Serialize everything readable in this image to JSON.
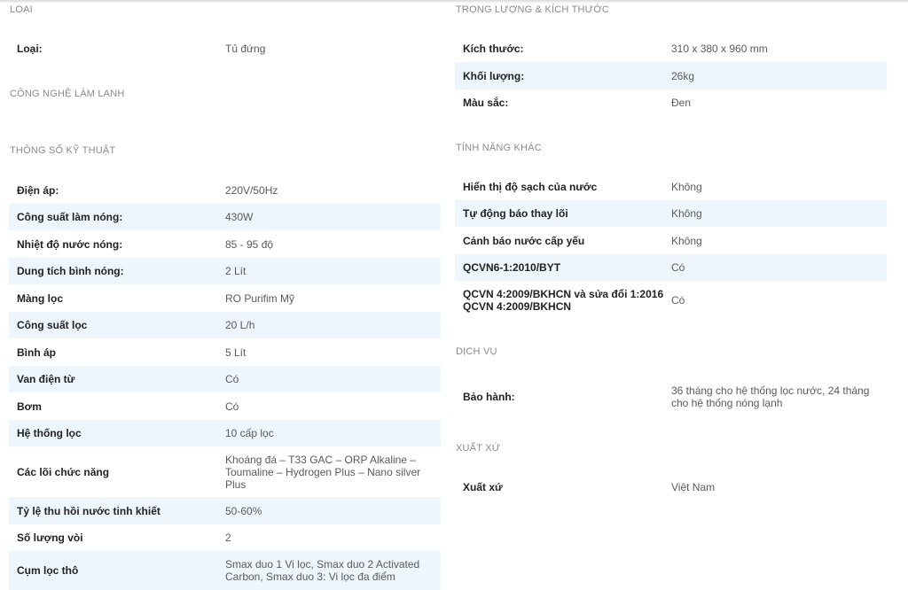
{
  "left": {
    "sections": [
      {
        "title": "LOẠI",
        "rows": [
          {
            "label": "Loại:",
            "value": "Tủ đứng"
          }
        ]
      },
      {
        "title": "CÔNG NGHỆ LÀM LẠNH",
        "rows": []
      },
      {
        "title": "THÔNG SỐ KỸ THUẬT",
        "rows": [
          {
            "label": "Điện áp:",
            "value": "220V/50Hz"
          },
          {
            "label": "Công suất làm nóng:",
            "value": "430W"
          },
          {
            "label": "Nhiệt độ nước nóng:",
            "value": "85 - 95 độ"
          },
          {
            "label": "Dung tích bình nóng:",
            "value": "2 Lít"
          },
          {
            "label": "Màng lọc",
            "value": "RO Purifim Mỹ"
          },
          {
            "label": "Công suất lọc",
            "value": "20 L/h"
          },
          {
            "label": "Bình áp",
            "value": "5 Lít"
          },
          {
            "label": "Van điện từ",
            "value": "Có"
          },
          {
            "label": "Bơm",
            "value": "Có"
          },
          {
            "label": "Hệ thống lọc",
            "value": "10 cấp lọc"
          },
          {
            "label": "Các lõi chức năng",
            "value": "Khoáng đá – T33 GAC – ORP Alkaline – Toumaline – Hydrogen Plus – Nano silver Plus"
          },
          {
            "label": "Tỷ lệ thu hồi nước tinh khiết",
            "value": "50-60%"
          },
          {
            "label": "Số lượng vòi",
            "value": "2"
          },
          {
            "label": "Cụm lọc thô",
            "value": "Smax duo 1 Vi lọc, Smax duo 2 Activated Carbon, Smax duo 3: Vi lọc đa điểm"
          }
        ]
      }
    ]
  },
  "right": {
    "sections": [
      {
        "title": "TRỌNG LƯỢNG & KÍCH THƯỚC",
        "rows": [
          {
            "label": "Kích thước:",
            "value": "310 x 380 x 960 mm"
          },
          {
            "label": "Khối lượng:",
            "value": "26kg"
          },
          {
            "label": "Màu sắc:",
            "value": "Đen"
          }
        ]
      },
      {
        "title": "TÍNH NĂNG KHÁC",
        "rows": [
          {
            "label": "Hiển thị độ sạch của nước",
            "value": "Không"
          },
          {
            "label": "Tự động báo thay lõi",
            "value": "Không"
          },
          {
            "label": "Cảnh báo nước cấp yếu",
            "value": "Không"
          },
          {
            "label": "QCVN6-1:2010/BYT",
            "value": "Có"
          },
          {
            "label": "QCVN 4:2009/BKHCN và sửa đổi 1:2016 QCVN 4:2009/BKHCN",
            "value": "Có"
          }
        ]
      },
      {
        "title": "DỊCH VỤ",
        "rows": [
          {
            "label": "Bảo hành:",
            "value": "36 tháng cho hệ thống lọc nước, 24 tháng cho hệ thống nóng lạnh"
          }
        ]
      },
      {
        "title": "XUẤT XỨ",
        "rows": [
          {
            "label": "Xuất xứ",
            "value": "Việt Nam"
          }
        ]
      }
    ]
  },
  "colors": {
    "row_alt": "#eef6fd",
    "section_title": "#8a8a8a",
    "label": "#222222",
    "value": "#5a5a5a"
  }
}
